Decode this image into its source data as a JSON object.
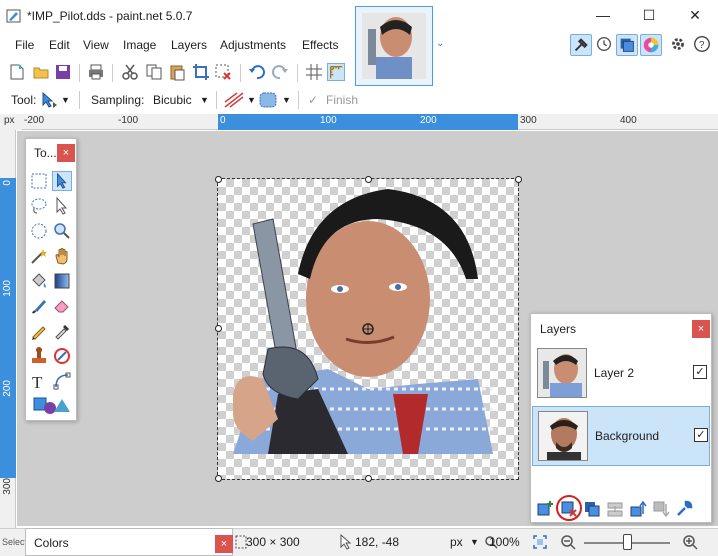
{
  "window": {
    "title": "*IMP_Pilot.dds - paint.net 5.0.7",
    "minimize": "—",
    "maximize": "☐",
    "close": "✕"
  },
  "menu": {
    "items": [
      "File",
      "Edit",
      "View",
      "Image",
      "Layers",
      "Adjustments",
      "Effects"
    ]
  },
  "options": {
    "tool_label": "Tool:",
    "sampling_label": "Sampling:",
    "sampling_value": "Bicubic",
    "finish_label": "Finish"
  },
  "rulers": {
    "unit": "px",
    "h_labels": [
      "-200",
      "-100",
      "0",
      "100",
      "200",
      "300",
      "400"
    ],
    "v_labels": [
      "0",
      "100",
      "200",
      "300"
    ]
  },
  "tools_window": {
    "title": "To...",
    "close": "×"
  },
  "layers_window": {
    "title": "Layers",
    "close": "×",
    "layers": [
      {
        "name": "Layer 2",
        "visible": true
      },
      {
        "name": "Background",
        "visible": true,
        "selected": true
      }
    ]
  },
  "colors_window": {
    "title": "Colors",
    "close": "×"
  },
  "status": {
    "selection_size": "300 × 300",
    "cursor_pos": "182, -48",
    "unit": "px",
    "zoom": "100%",
    "left_text": "Selecti"
  },
  "colors": {
    "accent": "#3b8fdd",
    "close_red": "#d9534f",
    "selection_blue": "#cce4f7"
  }
}
